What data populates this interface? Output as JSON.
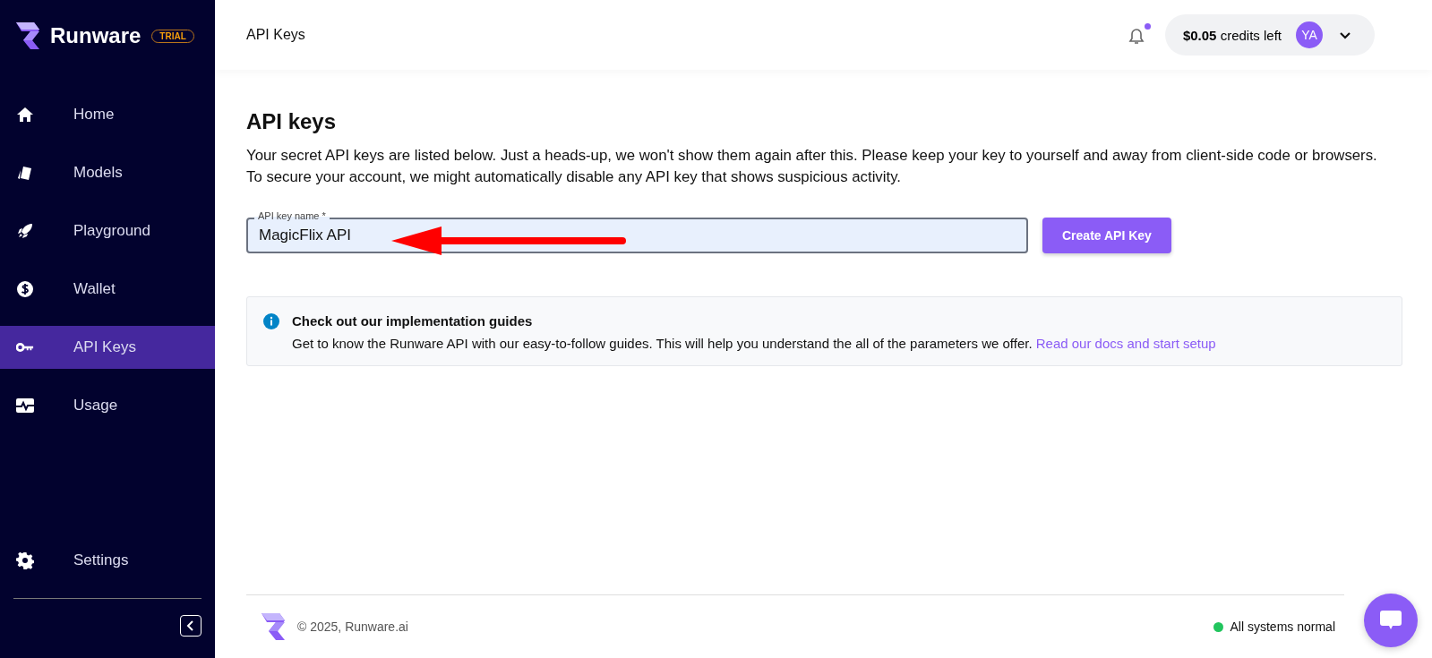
{
  "sidebar": {
    "brand": "Runware",
    "badge": "TRIAL",
    "items": [
      {
        "label": "Home",
        "selected": false
      },
      {
        "label": "Models",
        "selected": false
      },
      {
        "label": "Playground",
        "selected": false
      },
      {
        "label": "Wallet",
        "selected": false
      },
      {
        "label": "API Keys",
        "selected": true
      },
      {
        "label": "Usage",
        "selected": false
      }
    ],
    "settings": {
      "label": "Settings",
      "selected": false
    }
  },
  "header": {
    "title": "API Keys",
    "has_notification": true,
    "credits_amount": "$0.05",
    "credits_label": "credits left",
    "avatar": "YA"
  },
  "main": {
    "heading": "API keys",
    "description": [
      "Your secret API keys are listed below. Just a heads-up, we won't show them again after this. Please keep your key to yourself and away from client-side code or browsers.",
      "To secure your account, we might automatically disable any API key that shows suspicious activity."
    ],
    "field": {
      "label": "API key name *",
      "value": "MagicFlix API"
    },
    "button": "Create API Key",
    "annotation": {
      "kind": "arrow"
    },
    "info": {
      "title": "Check out our implementation guides",
      "text": "Get to know the Runware API with our easy-to-follow guides. This will help you understand the all of the parameters we offer.",
      "link": "Read our docs and start setup"
    }
  },
  "footer": {
    "copyright": "© 2025, Runware.ai",
    "status": {
      "label": "All systems normal",
      "color": "#22c55e"
    }
  }
}
